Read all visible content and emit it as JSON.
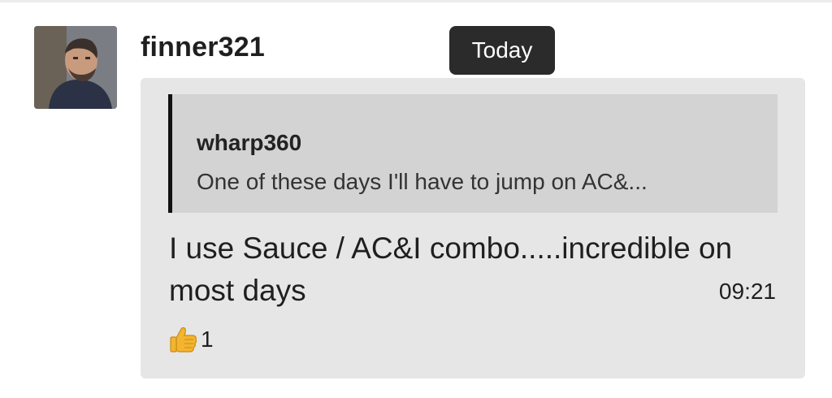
{
  "message": {
    "author": "finner321",
    "date_label": "Today",
    "avatar_icon": "user-avatar-photo",
    "quote": {
      "author": "wharp360",
      "text": "One of these days I'll have to jump on AC&..."
    },
    "body": "I use Sauce / AC&I combo.....incredible on most days",
    "time": "09:21",
    "reaction": {
      "icon": "thumbs-up-icon",
      "count": "1"
    }
  },
  "colors": {
    "bubble_bg": "#e6e6e6",
    "quote_bg": "#d3d3d3",
    "quote_bar": "#121212",
    "date_pill_bg": "#2b2b2b",
    "reaction_emoji": "#f3b52f"
  }
}
